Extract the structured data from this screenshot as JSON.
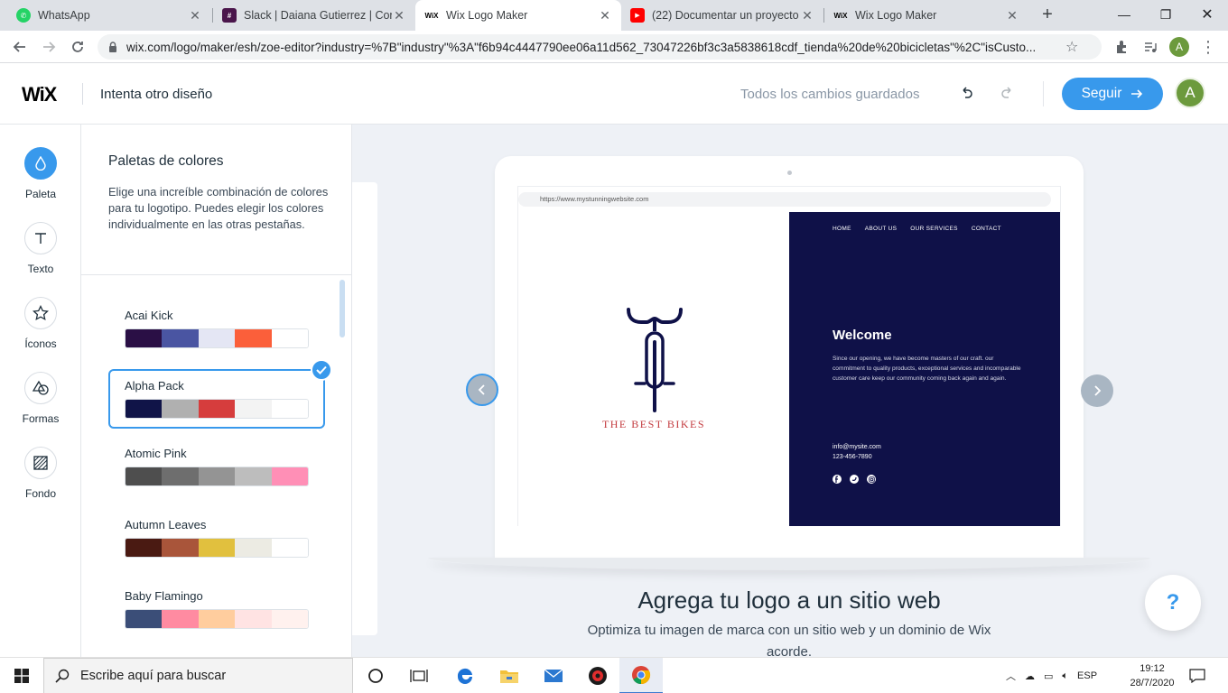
{
  "browser": {
    "tabs": [
      {
        "title": "WhatsApp",
        "favicon": "whatsapp-icon",
        "active": false
      },
      {
        "title": "Slack | Daiana Gutierrez | Comu",
        "favicon": "slack-icon",
        "active": false
      },
      {
        "title": "Wix Logo Maker",
        "favicon": "wix-icon",
        "active": true
      },
      {
        "title": "(22) Documentar un proyecto",
        "favicon": "youtube-icon",
        "active": false
      },
      {
        "title": "Wix Logo Maker",
        "favicon": "wix-icon",
        "active": false
      }
    ],
    "url": "wix.com/logo/maker/esh/zoe-editor?industry=%7B\"industry\"%3A\"f6b94c4447790ee06a11d562_73047226bf3c3a5838618cdf_tienda%20de%20bicicletas\"%2C\"isCusto...",
    "profile_initial": "A"
  },
  "wix": {
    "logo": "WiX",
    "try_other": "Intenta otro diseño",
    "saved_status": "Todos los cambios guardados",
    "continue_label": "Seguir",
    "user_initial": "A",
    "accent_color": "#3899ec"
  },
  "rail": [
    {
      "label": "Paleta",
      "icon": "droplet-icon",
      "active": true
    },
    {
      "label": "Texto",
      "icon": "text-icon",
      "active": false
    },
    {
      "label": "Íconos",
      "icon": "star-icon",
      "active": false
    },
    {
      "label": "Formas",
      "icon": "shapes-icon",
      "active": false
    },
    {
      "label": "Fondo",
      "icon": "background-icon",
      "active": false
    }
  ],
  "panel": {
    "title": "Paletas de colores",
    "description": "Elige una increíble combinación de colores para tu logotipo. Puedes elegir los colores individualmente en las otras pestañas.",
    "palettes": [
      {
        "name": "Acai Kick",
        "colors": [
          "#2a0f45",
          "#4a55a2",
          "#e4e6f4",
          "#fb5f3a",
          "#ffffff"
        ],
        "selected": false
      },
      {
        "name": "Alpha Pack",
        "colors": [
          "#101448",
          "#b0b0b0",
          "#d63d3d",
          "#f3f3f3",
          "#ffffff"
        ],
        "selected": true
      },
      {
        "name": "Atomic Pink",
        "colors": [
          "#4e4e4e",
          "#6e6e6e",
          "#949494",
          "#bdbdbd",
          "#ff8fb6"
        ],
        "selected": false
      },
      {
        "name": "Autumn Leaves",
        "colors": [
          "#4a1a12",
          "#a9553a",
          "#e1c03e",
          "#ecebe3",
          "#ffffff"
        ],
        "selected": false
      },
      {
        "name": "Baby Flamingo",
        "colors": [
          "#3b4e78",
          "#ff8ba1",
          "#ffcd9e",
          "#ffe3e3",
          "#fff1ee"
        ],
        "selected": false
      }
    ]
  },
  "preview": {
    "site_url": "https://www.mystunningwebsite.com",
    "brand_name": "THE BEST BIKES",
    "nav": [
      "HOME",
      "ABOUT US",
      "OUR SERVICES",
      "CONTACT"
    ],
    "welcome_title": "Welcome",
    "welcome_body": "Since our opening, we have become masters of our craft. our commitment to quality products, exceptional services and incomparable customer care keep our community coming back again and again.",
    "email": "info@mysite.com",
    "phone": "123-456-7890",
    "site_bg": "#0f1148",
    "brand_color": "#c33a3e"
  },
  "cta": {
    "title": "Agrega tu logo a un sitio web",
    "subtitle": "Optimiza tu imagen de marca con un sitio web y un dominio de Wix acorde."
  },
  "help_label": "?",
  "taskbar": {
    "search_placeholder": "Escribe aquí para buscar",
    "language": "ESP",
    "time": "19:12",
    "date": "28/7/2020"
  }
}
